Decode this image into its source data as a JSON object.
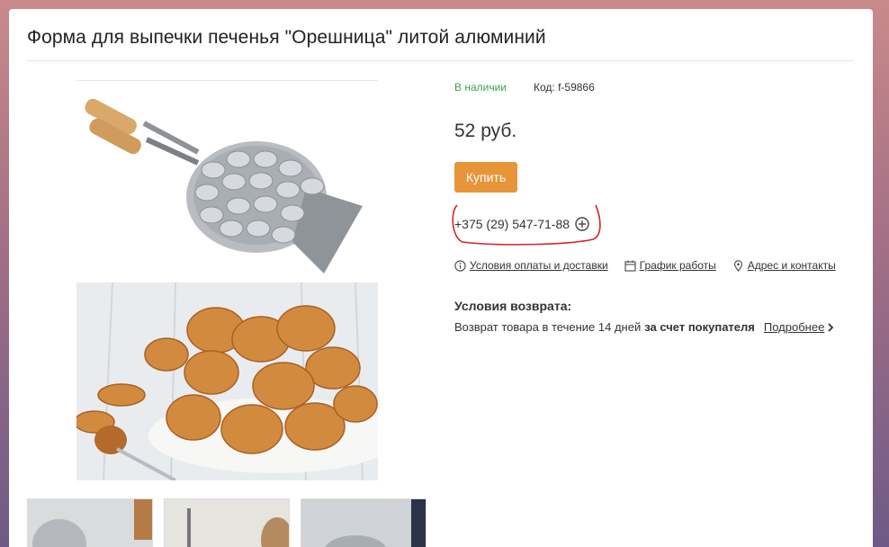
{
  "product": {
    "title": "Форма для выпечки печенья \"Орешница\" литой алюминий",
    "stock_status": "В наличии",
    "code": "Код: f-59866",
    "price": "52 руб.",
    "buy_label": "Купить",
    "phone": "+375 (29) 547-71-88"
  },
  "info_links": [
    {
      "label": "Условия оплаты и доставки",
      "icon": "info-icon"
    },
    {
      "label": "График работы",
      "icon": "calendar-icon"
    },
    {
      "label": "Адрес и контакты",
      "icon": "map-pin-icon"
    }
  ],
  "returns": {
    "title": "Условия возврата:",
    "text": "Возврат товара в течение 14 дней",
    "bold": "за счет покупателя",
    "more": "Подробнее"
  },
  "colors": {
    "stock": "#3fa34d",
    "buy_button": "#e8953a",
    "annotation": "#d8232a"
  }
}
